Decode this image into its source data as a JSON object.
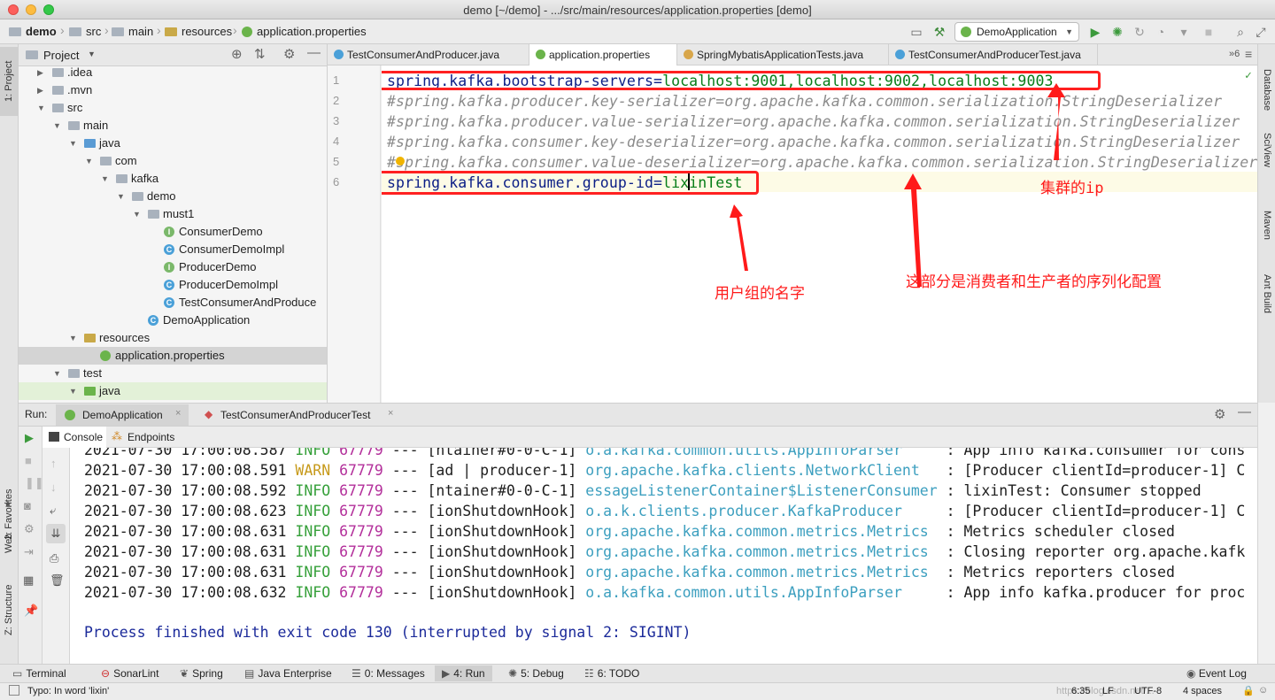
{
  "window": {
    "title": "demo [~/demo] - .../src/main/resources/application.properties [demo]"
  },
  "breadcrumb": [
    "demo",
    "src",
    "main",
    "resources",
    "application.properties"
  ],
  "toolbar": {
    "run_config": "DemoApplication"
  },
  "left_stripe": {
    "project": "1: Project",
    "favorites": "2: Favorites",
    "web": "Web",
    "structure": "Z: Structure"
  },
  "right_stripe": {
    "database": "Database",
    "sciview": "SciView",
    "maven": "Maven",
    "ant": "Ant Build"
  },
  "project_panel": {
    "title": "Project",
    "tree": [
      {
        "label": ".idea",
        "type": "folder",
        "depth": 1,
        "arrow": "right"
      },
      {
        "label": ".mvn",
        "type": "folder",
        "depth": 1,
        "arrow": "right"
      },
      {
        "label": "src",
        "type": "folder",
        "depth": 1,
        "arrow": "down"
      },
      {
        "label": "main",
        "type": "folder",
        "depth": 2,
        "arrow": "down"
      },
      {
        "label": "java",
        "type": "folder-blue",
        "depth": 3,
        "arrow": "down"
      },
      {
        "label": "com",
        "type": "package",
        "depth": 4,
        "arrow": "down"
      },
      {
        "label": "kafka",
        "type": "package",
        "depth": 5,
        "arrow": "down"
      },
      {
        "label": "demo",
        "type": "package",
        "depth": 6,
        "arrow": "down"
      },
      {
        "label": "must1",
        "type": "package",
        "depth": 7,
        "arrow": "down"
      },
      {
        "label": "ConsumerDemo",
        "type": "interface",
        "depth": 8,
        "arrow": ""
      },
      {
        "label": "ConsumerDemoImpl",
        "type": "class",
        "depth": 8,
        "arrow": ""
      },
      {
        "label": "ProducerDemo",
        "type": "interface",
        "depth": 8,
        "arrow": ""
      },
      {
        "label": "ProducerDemoImpl",
        "type": "class",
        "depth": 8,
        "arrow": ""
      },
      {
        "label": "TestConsumerAndProduce",
        "type": "class",
        "depth": 8,
        "arrow": ""
      },
      {
        "label": "DemoApplication",
        "type": "spring-class",
        "depth": 7,
        "arrow": ""
      },
      {
        "label": "resources",
        "type": "folder-res",
        "depth": 3,
        "arrow": "down"
      },
      {
        "label": "application.properties",
        "type": "properties",
        "depth": 4,
        "arrow": "",
        "selected": true
      },
      {
        "label": "test",
        "type": "folder",
        "depth": 2,
        "arrow": "down"
      },
      {
        "label": "java",
        "type": "folder-green",
        "depth": 3,
        "arrow": "down",
        "highlight": true
      }
    ]
  },
  "editor_tabs": [
    {
      "label": "TestConsumerAndProducer.java",
      "icon": "class",
      "active": false
    },
    {
      "label": "application.properties",
      "icon": "properties",
      "active": true
    },
    {
      "label": "SpringMybatisApplicationTests.java",
      "icon": "test",
      "active": false
    },
    {
      "label": "TestConsumerAndProducerTest.java",
      "icon": "test",
      "active": false
    }
  ],
  "editor_tab_count": "6",
  "editor": {
    "lines": [
      {
        "num": "1",
        "key": "spring.kafka.bootstrap-servers=",
        "value": "localhost:9001,localhost:9002,localhost:9003",
        "comment": false
      },
      {
        "num": "2",
        "text": "#spring.kafka.producer.key-serializer=org.apache.kafka.common.serialization.StringDeserializer",
        "comment": true
      },
      {
        "num": "3",
        "text": "#spring.kafka.producer.value-serializer=org.apache.kafka.common.serialization.StringDeserializer",
        "comment": true
      },
      {
        "num": "4",
        "text": "#spring.kafka.consumer.key-deserializer=org.apache.kafka.common.serialization.StringDeserializer",
        "comment": true
      },
      {
        "num": "5",
        "text": "#spring.kafka.consumer.value-deserializer=org.apache.kafka.common.serialization.StringDeserializer",
        "comment": true
      },
      {
        "num": "6",
        "key": "spring.kafka.consumer.group-id=",
        "value": "lixinTest",
        "comment": false
      }
    ]
  },
  "annotations": {
    "cluster_ip": "集群的ip",
    "serialization": "这部分是消费者和生产者的序列化配置",
    "group_name": "用户组的名字"
  },
  "run_panel": {
    "label": "Run:",
    "tabs": [
      "DemoApplication",
      "TestConsumerAndProducerTest"
    ],
    "sub_tabs": [
      "Console",
      "Endpoints"
    ]
  },
  "console": {
    "lines": [
      {
        "date": "2021-07-30 17:00:08.587",
        "level": "INFO",
        "pid": "67779",
        "sep": "---",
        "thread": "[ntainer#0-0-C-1]",
        "logger": "o.a.kafka.common.utils.AppInfoParser    ",
        "msg": ": App info kafka.consumer for cons"
      },
      {
        "date": "2021-07-30 17:00:08.591",
        "level": "WARN",
        "pid": "67779",
        "sep": "---",
        "thread": "[ad | producer-1]",
        "logger": "org.apache.kafka.clients.NetworkClient  ",
        "msg": ": [Producer clientId=producer-1] C"
      },
      {
        "date": "2021-07-30 17:00:08.592",
        "level": "INFO",
        "pid": "67779",
        "sep": "---",
        "thread": "[ntainer#0-0-C-1]",
        "logger": "essageListenerContainer$ListenerConsumer",
        "msg": ": lixinTest: Consumer stopped"
      },
      {
        "date": "2021-07-30 17:00:08.623",
        "level": "INFO",
        "pid": "67779",
        "sep": "---",
        "thread": "[ionShutdownHook]",
        "logger": "o.a.k.clients.producer.KafkaProducer    ",
        "msg": ": [Producer clientId=producer-1] C"
      },
      {
        "date": "2021-07-30 17:00:08.631",
        "level": "INFO",
        "pid": "67779",
        "sep": "---",
        "thread": "[ionShutdownHook]",
        "logger": "org.apache.kafka.common.metrics.Metrics ",
        "msg": ": Metrics scheduler closed"
      },
      {
        "date": "2021-07-30 17:00:08.631",
        "level": "INFO",
        "pid": "67779",
        "sep": "---",
        "thread": "[ionShutdownHook]",
        "logger": "org.apache.kafka.common.metrics.Metrics ",
        "msg": ": Closing reporter org.apache.kafk"
      },
      {
        "date": "2021-07-30 17:00:08.631",
        "level": "INFO",
        "pid": "67779",
        "sep": "---",
        "thread": "[ionShutdownHook]",
        "logger": "org.apache.kafka.common.metrics.Metrics ",
        "msg": ": Metrics reporters closed"
      },
      {
        "date": "2021-07-30 17:00:08.632",
        "level": "INFO",
        "pid": "67779",
        "sep": "---",
        "thread": "[ionShutdownHook]",
        "logger": "o.a.kafka.common.utils.AppInfoParser    ",
        "msg": ": App info kafka.producer for proc"
      }
    ],
    "exit_message": "Process finished with exit code 130 (interrupted by signal 2: SIGINT)"
  },
  "bottom_tools": [
    {
      "label": "Terminal",
      "icon": "terminal-icon"
    },
    {
      "label": "SonarLint",
      "icon": "sonarlint-icon"
    },
    {
      "label": "Spring",
      "icon": "spring-icon"
    },
    {
      "label": "Java Enterprise",
      "icon": "java-enterprise-icon"
    },
    {
      "label": "0: Messages",
      "icon": "messages-icon"
    },
    {
      "label": "4: Run",
      "icon": "run-icon",
      "active": true
    },
    {
      "label": "5: Debug",
      "icon": "debug-icon"
    },
    {
      "label": "6: TODO",
      "icon": "todo-icon"
    }
  ],
  "event_log": "Event Log",
  "status": {
    "message": "Typo: In word 'lixin'",
    "position": "6:35",
    "line_sep": "LF",
    "encoding": "UTF-8",
    "indent": "4 spaces",
    "watermark": "https://blog.csdn.net/..."
  },
  "colors": {
    "annotation_red": "#ff1a1a",
    "key_blue": "#0b1e86",
    "value_green": "#067d17",
    "comment_gray": "#8c8c8c"
  }
}
